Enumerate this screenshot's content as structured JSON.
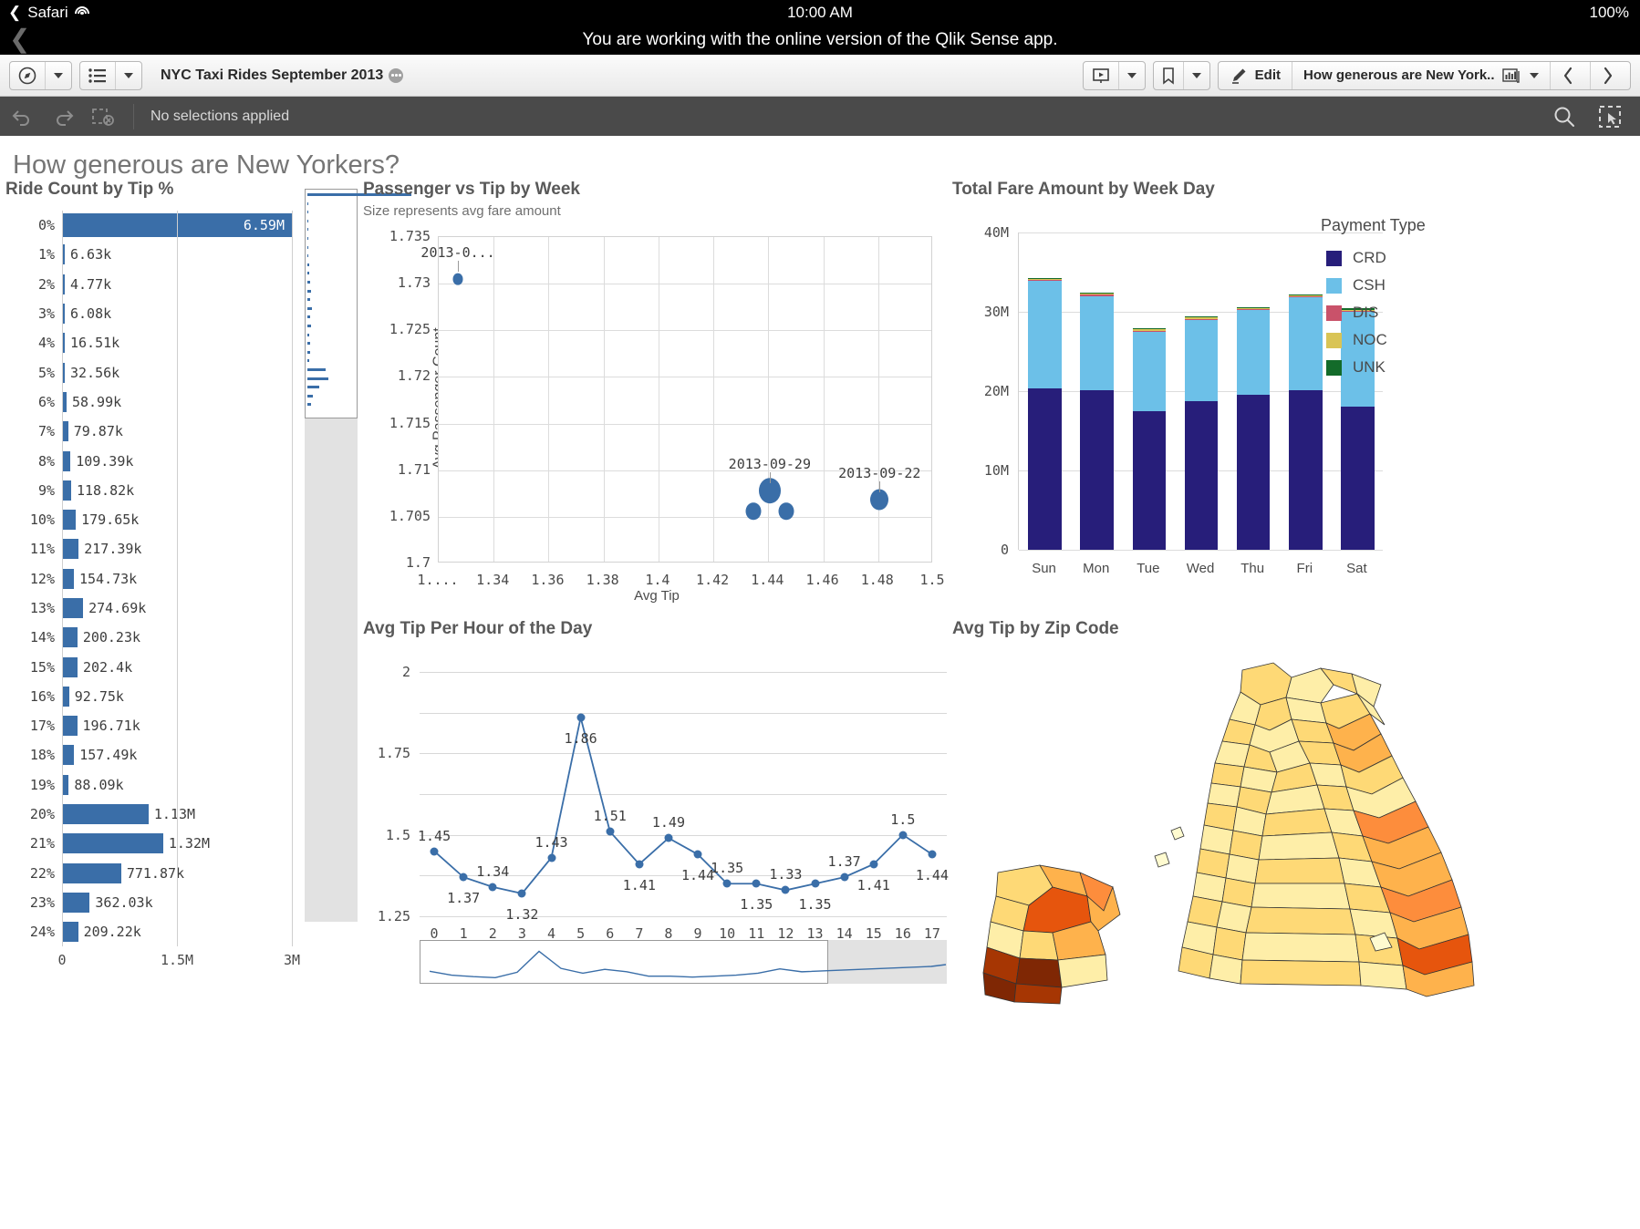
{
  "status_bar": {
    "back_label": "Safari",
    "wifi_icon": "wifi-icon",
    "time": "10:00 AM",
    "battery": "100%"
  },
  "safari_banner": {
    "back_icon": "chevron-left-icon",
    "message": "You are working with the online version of the Qlik Sense app."
  },
  "toolbar": {
    "nav_icon": "compass-icon",
    "nav_caret_icon": "chevron-down-icon",
    "sheets_icon": "list-icon",
    "sheets_caret_icon": "chevron-down-icon",
    "app_title": "NYC Taxi Rides September 2013",
    "app_badge_icon": "more-dots-icon",
    "story_icon": "storytelling-icon",
    "story_caret_icon": "chevron-down-icon",
    "bookmark_icon": "bookmark-icon",
    "bookmark_caret_icon": "chevron-down-icon",
    "edit_icon": "pencil-icon",
    "edit_label": "Edit",
    "sheet_name": "How generous are New York...",
    "sheet_icon": "sheet-thumbnail-icon",
    "sheet_caret_icon": "chevron-down-icon",
    "prev_icon": "chevron-left-icon",
    "next_icon": "chevron-right-icon"
  },
  "selection_bar": {
    "back_icon": "undo-icon",
    "forward_icon": "redo-icon",
    "clear_icon": "clear-selections-icon",
    "status": "No selections applied",
    "search_icon": "search-icon",
    "selection_tool_icon": "selection-tool-icon"
  },
  "sheet": {
    "title": "How generous are New Yorkers?"
  },
  "chart_data": [
    {
      "type": "bar",
      "orientation": "horizontal",
      "title": "Ride Count by Tip %",
      "xlabel": "",
      "ylabel": "",
      "xlim": [
        0,
        3000000
      ],
      "xticks": [
        "0",
        "1.5M",
        "3M"
      ],
      "categories": [
        "0%",
        "1%",
        "2%",
        "3%",
        "4%",
        "5%",
        "6%",
        "7%",
        "8%",
        "9%",
        "10%",
        "11%",
        "12%",
        "13%",
        "14%",
        "15%",
        "16%",
        "17%",
        "18%",
        "19%",
        "20%",
        "21%",
        "22%",
        "23%",
        "24%"
      ],
      "value_labels": [
        "6.59M",
        "6.63k",
        "4.77k",
        "6.08k",
        "16.51k",
        "32.56k",
        "58.99k",
        "79.87k",
        "109.39k",
        "118.82k",
        "179.65k",
        "217.39k",
        "154.73k",
        "274.69k",
        "200.23k",
        "202.4k",
        "92.75k",
        "196.71k",
        "157.49k",
        "88.09k",
        "1.13M",
        "1.32M",
        "771.87k",
        "362.03k",
        "209.22k"
      ],
      "values": [
        6590000,
        6630,
        4770,
        6080,
        16510,
        32560,
        58990,
        79870,
        109390,
        118820,
        179650,
        217390,
        154730,
        274690,
        200230,
        202400,
        92750,
        196710,
        157490,
        88090,
        1130000,
        1320000,
        771870,
        362030,
        209220
      ],
      "bar_color": "#3a6ea8",
      "grid": true
    },
    {
      "type": "scatter",
      "title": "Passenger vs Tip by Week",
      "subtitle": "Size represents avg fare amount",
      "xlabel": "Avg Tip",
      "ylabel": "Avg Passenger Count",
      "xlim": [
        1.32,
        1.5
      ],
      "ylim": [
        1.7,
        1.735
      ],
      "xticks": [
        "1....",
        "1.34",
        "1.36",
        "1.38",
        "1.4",
        "1.42",
        "1.44",
        "1.46",
        "1.48",
        "1.5"
      ],
      "yticks": [
        "1.7",
        "1.705",
        "1.71",
        "1.715",
        "1.72",
        "1.725",
        "1.73",
        "1.735"
      ],
      "point_color": "#3a6ea8",
      "points": [
        {
          "label": "2013-0...",
          "x": 1.327,
          "y": 1.7305,
          "size": 11,
          "show_label": true
        },
        {
          "label": "2013-09-29",
          "x": 1.4405,
          "y": 1.7078,
          "size": 24,
          "show_label": true
        },
        {
          "label": "",
          "x": 1.4345,
          "y": 1.7056,
          "size": 17,
          "show_label": false
        },
        {
          "label": "",
          "x": 1.4465,
          "y": 1.7056,
          "size": 17,
          "show_label": false
        },
        {
          "label": "2013-09-22",
          "x": 1.4805,
          "y": 1.7068,
          "size": 20,
          "show_label": true
        }
      ]
    },
    {
      "type": "bar",
      "stacked": true,
      "title": "Total Fare Amount by Week Day",
      "xlabel": "",
      "ylabel": "",
      "ylim": [
        0,
        40000000
      ],
      "yticks": [
        "0",
        "10M",
        "20M",
        "30M",
        "40M"
      ],
      "categories": [
        "Sun",
        "Mon",
        "Tue",
        "Wed",
        "Thu",
        "Fri",
        "Sat"
      ],
      "legend_title": "Payment Type",
      "legend_position": "right",
      "series": [
        {
          "name": "CRD",
          "color": "#271e7a",
          "values": [
            20400000,
            20100000,
            17500000,
            18700000,
            19500000,
            20100000,
            18100000
          ]
        },
        {
          "name": "CSH",
          "color": "#6cc0e8",
          "values": [
            13500000,
            11900000,
            10000000,
            10300000,
            10700000,
            11700000,
            11900000
          ]
        },
        {
          "name": "DIS",
          "color": "#c9526a",
          "values": [
            30000,
            28000,
            25000,
            26000,
            27000,
            29000,
            28000
          ]
        },
        {
          "name": "NOC",
          "color": "#d9c455",
          "values": [
            60000,
            58000,
            52000,
            54000,
            56000,
            60000,
            58000
          ]
        },
        {
          "name": "UNK",
          "color": "#136b2a",
          "values": [
            110000,
            105000,
            95000,
            100000,
            102000,
            108000,
            104000
          ]
        }
      ]
    },
    {
      "type": "line",
      "title": "Avg Tip Per Hour of the Day",
      "xlabel": "",
      "ylabel": "",
      "ylim": [
        1.25,
        2
      ],
      "yticks": [
        "1.25",
        "1.5",
        "1.75",
        "2"
      ],
      "line_color": "#3a6ea8",
      "categories": [
        "0",
        "1",
        "2",
        "3",
        "4",
        "5",
        "6",
        "7",
        "8",
        "9",
        "10",
        "11",
        "12",
        "13",
        "14",
        "15",
        "16",
        "17"
      ],
      "values": [
        1.45,
        1.37,
        1.34,
        1.32,
        1.43,
        1.86,
        1.51,
        1.41,
        1.49,
        1.44,
        1.35,
        1.35,
        1.33,
        1.35,
        1.37,
        1.41,
        1.5,
        1.44
      ],
      "value_labels": [
        "1.45",
        "1.37",
        "1.34",
        "1.32",
        "1.43",
        "1.86",
        "1.51",
        "1.41",
        "1.49",
        "1.44",
        "1.35",
        "1.35",
        "1.33",
        "1.35",
        "1.37",
        "1.41",
        "1.5",
        "1.44"
      ]
    },
    {
      "type": "heatmap",
      "title": "Avg Tip by Zip Code",
      "subtitle": "",
      "description": "NYC zip code choropleth map shaded from light yellow (low avg tip) to dark brown (high avg tip)",
      "colors": [
        "#fffbd0",
        "#feeea8",
        "#fed976",
        "#feb24c",
        "#fd8d3c",
        "#e6550d",
        "#a63603",
        "#7f2704"
      ]
    }
  ]
}
